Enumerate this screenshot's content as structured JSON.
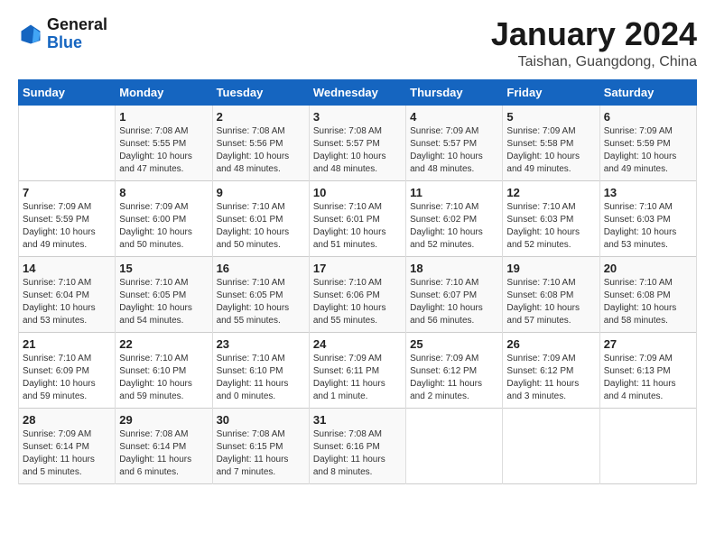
{
  "header": {
    "logo_general": "General",
    "logo_blue": "Blue",
    "month_title": "January 2024",
    "location": "Taishan, Guangdong, China"
  },
  "days_of_week": [
    "Sunday",
    "Monday",
    "Tuesday",
    "Wednesday",
    "Thursday",
    "Friday",
    "Saturday"
  ],
  "weeks": [
    [
      {
        "day": "",
        "info": ""
      },
      {
        "day": "1",
        "info": "Sunrise: 7:08 AM\nSunset: 5:55 PM\nDaylight: 10 hours\nand 47 minutes."
      },
      {
        "day": "2",
        "info": "Sunrise: 7:08 AM\nSunset: 5:56 PM\nDaylight: 10 hours\nand 48 minutes."
      },
      {
        "day": "3",
        "info": "Sunrise: 7:08 AM\nSunset: 5:57 PM\nDaylight: 10 hours\nand 48 minutes."
      },
      {
        "day": "4",
        "info": "Sunrise: 7:09 AM\nSunset: 5:57 PM\nDaylight: 10 hours\nand 48 minutes."
      },
      {
        "day": "5",
        "info": "Sunrise: 7:09 AM\nSunset: 5:58 PM\nDaylight: 10 hours\nand 49 minutes."
      },
      {
        "day": "6",
        "info": "Sunrise: 7:09 AM\nSunset: 5:59 PM\nDaylight: 10 hours\nand 49 minutes."
      }
    ],
    [
      {
        "day": "7",
        "info": "Sunrise: 7:09 AM\nSunset: 5:59 PM\nDaylight: 10 hours\nand 49 minutes."
      },
      {
        "day": "8",
        "info": "Sunrise: 7:09 AM\nSunset: 6:00 PM\nDaylight: 10 hours\nand 50 minutes."
      },
      {
        "day": "9",
        "info": "Sunrise: 7:10 AM\nSunset: 6:01 PM\nDaylight: 10 hours\nand 50 minutes."
      },
      {
        "day": "10",
        "info": "Sunrise: 7:10 AM\nSunset: 6:01 PM\nDaylight: 10 hours\nand 51 minutes."
      },
      {
        "day": "11",
        "info": "Sunrise: 7:10 AM\nSunset: 6:02 PM\nDaylight: 10 hours\nand 52 minutes."
      },
      {
        "day": "12",
        "info": "Sunrise: 7:10 AM\nSunset: 6:03 PM\nDaylight: 10 hours\nand 52 minutes."
      },
      {
        "day": "13",
        "info": "Sunrise: 7:10 AM\nSunset: 6:03 PM\nDaylight: 10 hours\nand 53 minutes."
      }
    ],
    [
      {
        "day": "14",
        "info": "Sunrise: 7:10 AM\nSunset: 6:04 PM\nDaylight: 10 hours\nand 53 minutes."
      },
      {
        "day": "15",
        "info": "Sunrise: 7:10 AM\nSunset: 6:05 PM\nDaylight: 10 hours\nand 54 minutes."
      },
      {
        "day": "16",
        "info": "Sunrise: 7:10 AM\nSunset: 6:05 PM\nDaylight: 10 hours\nand 55 minutes."
      },
      {
        "day": "17",
        "info": "Sunrise: 7:10 AM\nSunset: 6:06 PM\nDaylight: 10 hours\nand 55 minutes."
      },
      {
        "day": "18",
        "info": "Sunrise: 7:10 AM\nSunset: 6:07 PM\nDaylight: 10 hours\nand 56 minutes."
      },
      {
        "day": "19",
        "info": "Sunrise: 7:10 AM\nSunset: 6:08 PM\nDaylight: 10 hours\nand 57 minutes."
      },
      {
        "day": "20",
        "info": "Sunrise: 7:10 AM\nSunset: 6:08 PM\nDaylight: 10 hours\nand 58 minutes."
      }
    ],
    [
      {
        "day": "21",
        "info": "Sunrise: 7:10 AM\nSunset: 6:09 PM\nDaylight: 10 hours\nand 59 minutes."
      },
      {
        "day": "22",
        "info": "Sunrise: 7:10 AM\nSunset: 6:10 PM\nDaylight: 10 hours\nand 59 minutes."
      },
      {
        "day": "23",
        "info": "Sunrise: 7:10 AM\nSunset: 6:10 PM\nDaylight: 11 hours\nand 0 minutes."
      },
      {
        "day": "24",
        "info": "Sunrise: 7:09 AM\nSunset: 6:11 PM\nDaylight: 11 hours\nand 1 minute."
      },
      {
        "day": "25",
        "info": "Sunrise: 7:09 AM\nSunset: 6:12 PM\nDaylight: 11 hours\nand 2 minutes."
      },
      {
        "day": "26",
        "info": "Sunrise: 7:09 AM\nSunset: 6:12 PM\nDaylight: 11 hours\nand 3 minutes."
      },
      {
        "day": "27",
        "info": "Sunrise: 7:09 AM\nSunset: 6:13 PM\nDaylight: 11 hours\nand 4 minutes."
      }
    ],
    [
      {
        "day": "28",
        "info": "Sunrise: 7:09 AM\nSunset: 6:14 PM\nDaylight: 11 hours\nand 5 minutes."
      },
      {
        "day": "29",
        "info": "Sunrise: 7:08 AM\nSunset: 6:14 PM\nDaylight: 11 hours\nand 6 minutes."
      },
      {
        "day": "30",
        "info": "Sunrise: 7:08 AM\nSunset: 6:15 PM\nDaylight: 11 hours\nand 7 minutes."
      },
      {
        "day": "31",
        "info": "Sunrise: 7:08 AM\nSunset: 6:16 PM\nDaylight: 11 hours\nand 8 minutes."
      },
      {
        "day": "",
        "info": ""
      },
      {
        "day": "",
        "info": ""
      },
      {
        "day": "",
        "info": ""
      }
    ]
  ]
}
